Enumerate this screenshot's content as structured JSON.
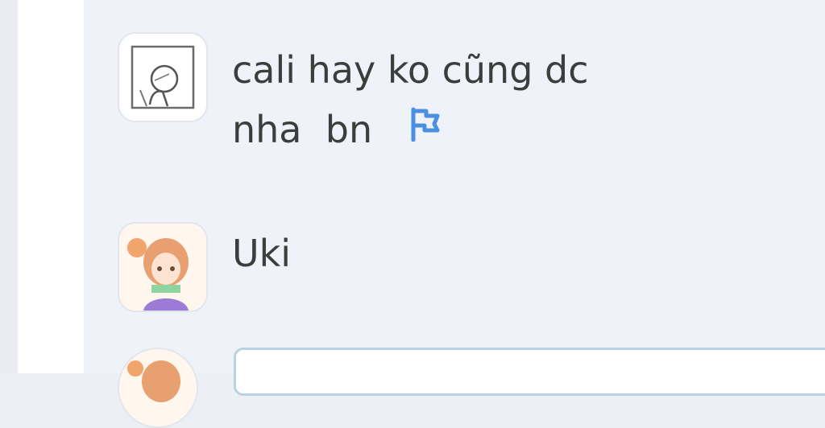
{
  "comments": [
    {
      "text_line1": "cali hay ko cũng dc",
      "text_line2": "nha  bn",
      "avatar_icon": "sketch-person-avatar",
      "report_icon": "flag-icon"
    },
    {
      "text_line1": "Uki",
      "avatar_icon": "anime-girl-avatar"
    }
  ],
  "reply": {
    "avatar_icon": "anime-girl-avatar"
  },
  "colors": {
    "panel_bg": "#eff2f9",
    "text": "#3d3d3d",
    "flag": "#4a90e2",
    "input_border": "#b9d3e1"
  }
}
